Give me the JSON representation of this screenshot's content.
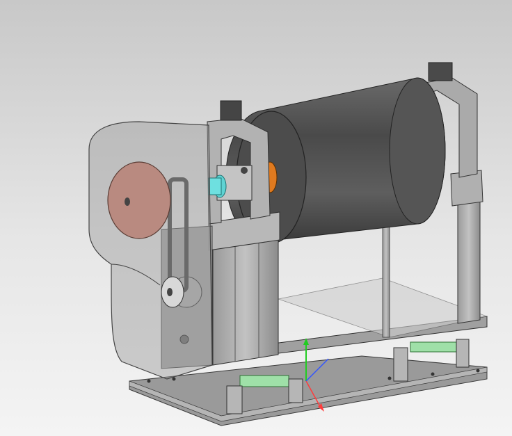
{
  "viewport": {
    "background_top": "#c8c8c8",
    "background_bottom": "#f4f4f4"
  },
  "model": {
    "parts": [
      {
        "name": "main-drum",
        "color": "#4f4f4f"
      },
      {
        "name": "drum-end-hub",
        "color": "#e07a1f"
      },
      {
        "name": "transparent-guard",
        "color": "#9c9c9c"
      },
      {
        "name": "pulley",
        "color": "#b98a80"
      },
      {
        "name": "coupling",
        "color": "#5fd3d3"
      },
      {
        "name": "linear-rail-blocks",
        "color": "#9fe0a8"
      },
      {
        "name": "frame",
        "color": "#a9a9a9"
      },
      {
        "name": "base-plate",
        "color": "#8c8c8c"
      }
    ]
  },
  "triad": {
    "x_color": "#ff3b3b",
    "y_color": "#22cc22",
    "z_color": "#3355ff"
  }
}
